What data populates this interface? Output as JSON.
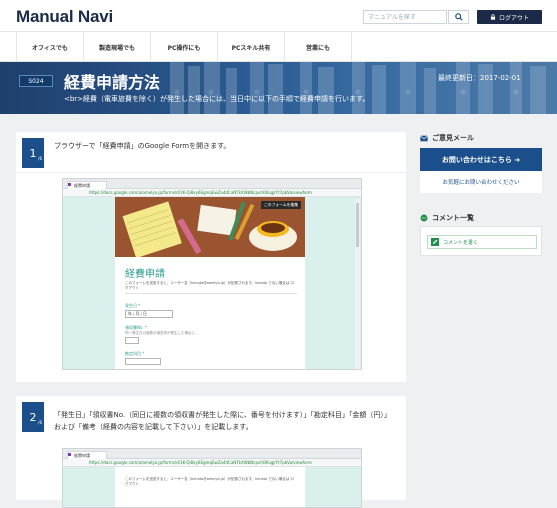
{
  "header": {
    "logo": "Manual Navi",
    "search_placeholder": "マニュアルを探す",
    "logout_label": "ログアウト"
  },
  "nav": {
    "items": [
      "オフィスでも",
      "製造現場でも",
      "PC操作にも",
      "PCスキル共有",
      "営業にも"
    ]
  },
  "hero": {
    "badge": "S024",
    "title": "経費申請方法",
    "subtitle": "<br>経費（電車旅費を除く）が発生した場合には、当日中に以下の手順で経費申請を行います。",
    "updated": "最終更新日：2017-02-01"
  },
  "steps": [
    {
      "number": "1",
      "sub": "/6",
      "text": "ブラウザーで「経費申請」のGoogle Formを開きます。",
      "screenshot": {
        "tab_label": "経費申請",
        "url": "https://docs.google.com/a/amelya.jp/forms/d/1K-Qi8xy6EgmqEwZa4dCaNTkXWbNcpvhOKsgjlYt7pbVa/viewform",
        "form_title": "経費申請",
        "form_desc": "このフォームを送信すると、ユーザー名（kimoto@amelya.jp）が記録されます。kimoto でない場合は ログアウト",
        "edit_label": "このフォームを編集",
        "fields": [
          {
            "label": "発生日 *",
            "value": "年 / 月 / 日"
          },
          {
            "label": "領収書No. *",
            "value": ""
          },
          {
            "label": "勘定科目 *",
            "value": ""
          }
        ],
        "field_help": "同一発生日の複数の領収書が発生した場合に..."
      }
    },
    {
      "number": "2",
      "sub": "/6",
      "text": "「発生日」「領収書No.（同日に複数の領収書が発生した際に、番号を付けます）」「勘定科目」「金額（円）」および「備考（経費の内容を記載して下さい）」を記載します。",
      "screenshot": {
        "tab_label": "経費申請",
        "url": "https://docs.google.com/a/amelya.jp/forms/d/1K-Qi8xy6EgmqEwZa4dCaNTkXWbNcpvhOKsgjlYt7pbVa/viewform",
        "form_desc": "このフォームを送信すると、ユーザー名（kimoto@amelya.jp）が記録されます。kimoto でない場合は ログアウト"
      }
    }
  ],
  "sidebar": {
    "mail_heading": "ご意見メール",
    "mail_button": "お問い合わせはこちら ➜",
    "mail_link": "お気軽にお問い合わせください",
    "comment_heading": "コメント一覧",
    "comment_button": "コメントを書く"
  },
  "colors": {
    "navy": "#1a2a48",
    "primary": "#1a4f8c",
    "green": "#1f8d4c",
    "form_teal": "#2e9d8f"
  }
}
